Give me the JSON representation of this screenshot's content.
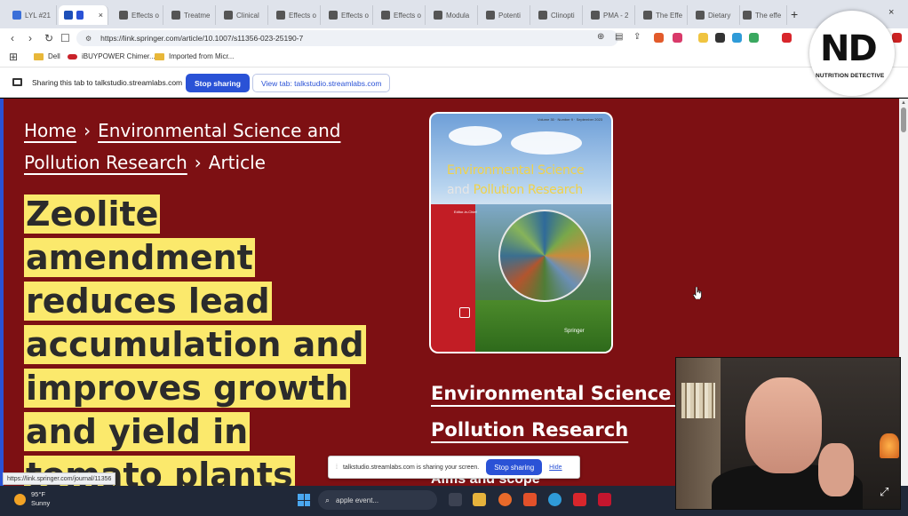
{
  "browser": {
    "tabs": [
      {
        "title": "LYL #21",
        "fav": "#3b6fd8"
      },
      {
        "title": "",
        "fav": "#1d4fb8",
        "active": true
      },
      {
        "title": "Effects o",
        "fav": "#555"
      },
      {
        "title": "Treatme",
        "fav": "#555"
      },
      {
        "title": "Clinical",
        "fav": "#555"
      },
      {
        "title": "Effects o",
        "fav": "#555"
      },
      {
        "title": "Effects o",
        "fav": "#555"
      },
      {
        "title": "Effects o",
        "fav": "#555"
      },
      {
        "title": "Modula",
        "fav": "#555"
      },
      {
        "title": "Potenti",
        "fav": "#555"
      },
      {
        "title": "Clinopti",
        "fav": "#555"
      },
      {
        "title": "PMA - 2",
        "fav": "#555"
      },
      {
        "title": "The Effe",
        "fav": "#555"
      },
      {
        "title": "Dietary",
        "fav": "#555"
      },
      {
        "title": "The effe",
        "fav": "#555"
      }
    ],
    "tab_close": "×",
    "new_tab": "+",
    "win_close": "×",
    "url": "https://link.springer.com/article/10.1007/s11356-023-25190-7",
    "bookmarks": [
      "Dell",
      "iBUYPOWER Chimer...",
      "Imported from Micr..."
    ]
  },
  "sharing_bar": {
    "text": "Sharing this tab to talkstudio.streamlabs.com",
    "stop_label": "Stop sharing",
    "view_label": "View tab: talkstudio.streamlabs.com"
  },
  "page": {
    "breadcrumb": {
      "home": "Home",
      "section": "Environmental Science and Pollution Research",
      "current": "Article",
      "sep": "›"
    },
    "title": "Zeolite amendment reduces lead accumulation and improves growth and yield in tomato plants",
    "cover": {
      "meta": "Volume 30 · Number 9 · September 2023",
      "title_line1": "Environmental Science",
      "title_and": "and",
      "title_line2": "Pollution Research",
      "editor": "Editor-in-Chief",
      "publisher": "Springer"
    },
    "journal_name": "Environmental Science and Pollution Research",
    "aims": "Aims and scope"
  },
  "status_url": "https://link.springer.com/journal/11356",
  "share_notice": {
    "text": "talkstudio.streamlabs.com is sharing your screen.",
    "stop_label": "Stop sharing",
    "hide_label": "Hide"
  },
  "taskbar": {
    "temperature": "95°F",
    "condition": "Sunny",
    "search_text": "apple event..."
  },
  "overlay": {
    "logo_mark": "ND",
    "logo_text": "NUTRITION DETECTIVE"
  }
}
